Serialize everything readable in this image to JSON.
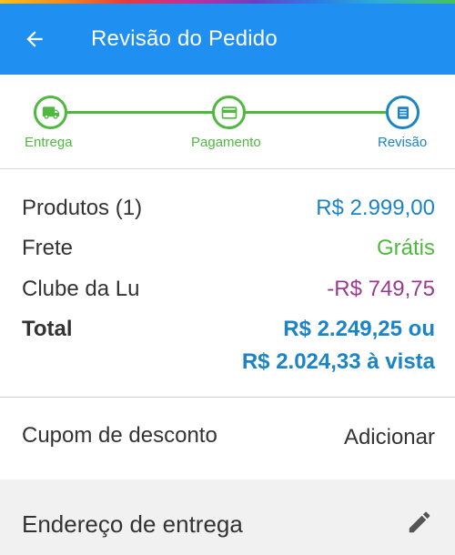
{
  "colors": {
    "appbar": "#1f8ff1",
    "step_done": "#4fb83f",
    "step_current": "#1b84c7",
    "price_blue": "#1b84c7",
    "free_green": "#4fb83f",
    "discount_purple": "#9b3a8f",
    "text": "#333333"
  },
  "header": {
    "title": "Revisão do Pedido",
    "back_icon": "arrow-left-icon"
  },
  "stepper": {
    "steps": [
      {
        "label": "Entrega",
        "icon": "truck-icon",
        "state": "done"
      },
      {
        "label": "Pagamento",
        "icon": "credit-card-icon",
        "state": "done"
      },
      {
        "label": "Revisão",
        "icon": "list-icon",
        "state": "current"
      }
    ]
  },
  "summary": {
    "products": {
      "label": "Produtos (1)",
      "value": "R$ 2.999,00"
    },
    "shipping": {
      "label": "Frete",
      "value": "Grátis"
    },
    "club": {
      "label": "Clube da Lu",
      "value": "-R$ 749,75"
    },
    "total": {
      "label": "Total",
      "value_line1": "R$ 2.249,25 ou",
      "value_line2": "R$ 2.024,33 à vista"
    }
  },
  "coupon": {
    "label": "Cupom de desconto",
    "action": "Adicionar"
  },
  "address": {
    "label": "Endereço de entrega",
    "edit_icon": "pencil-icon"
  }
}
